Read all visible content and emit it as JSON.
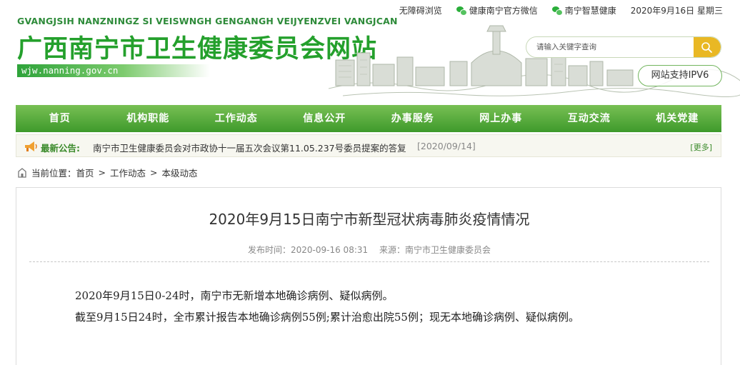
{
  "topbar": {
    "accessibility": "无障碍浏览",
    "wechat_official": "健康南宁官方微信",
    "smart_health": "南宁智慧健康",
    "date": "2020年9月16日 星期三"
  },
  "header": {
    "pinyin": "GVANGJSIH NANZNINGZ SI VEISWNGH GENGANGH VEIJYENZVEI VANGJCAN",
    "site_name": "广西南宁市卫生健康委员会网站",
    "domain": "wjw.nanning.gov.cn"
  },
  "search": {
    "placeholder": "请输入关键字查询"
  },
  "ipv6_badge": "网站支持IPV6",
  "nav": [
    {
      "label": "首页"
    },
    {
      "label": "机构职能"
    },
    {
      "label": "工作动态"
    },
    {
      "label": "信息公开"
    },
    {
      "label": "办事服务"
    },
    {
      "label": "网上办事"
    },
    {
      "label": "互动交流"
    },
    {
      "label": "机关党建"
    }
  ],
  "notice": {
    "label": "最新公告:",
    "text": "南宁市卫生健康委员会对市政协十一届五次会议第11.05.237号委员提案的答复",
    "date": "[2020/09/14]",
    "more": "[更多]"
  },
  "breadcrumb": {
    "prefix": "当前位置：",
    "home": "首页",
    "sep": ">",
    "level1": "工作动态",
    "level2": "本级动态"
  },
  "article": {
    "title": "2020年9月15日南宁市新型冠状病毒肺炎疫情情况",
    "publish_time": "发布时间：2020-09-16 08:31",
    "source": "来源：南宁市卫生健康委员会",
    "paragraph1": "2020年9月15日0-24时，南宁市无新增本地确诊病例、疑似病例。",
    "paragraph2": "截至9月15日24时，全市累计报告本地确诊病例55例;累计治愈出院55例；现无本地确诊病例、疑似病例。"
  },
  "colors": {
    "brand_green": "#24a02c",
    "nav_green": "#4ea634",
    "search_button": "#e9b824"
  }
}
